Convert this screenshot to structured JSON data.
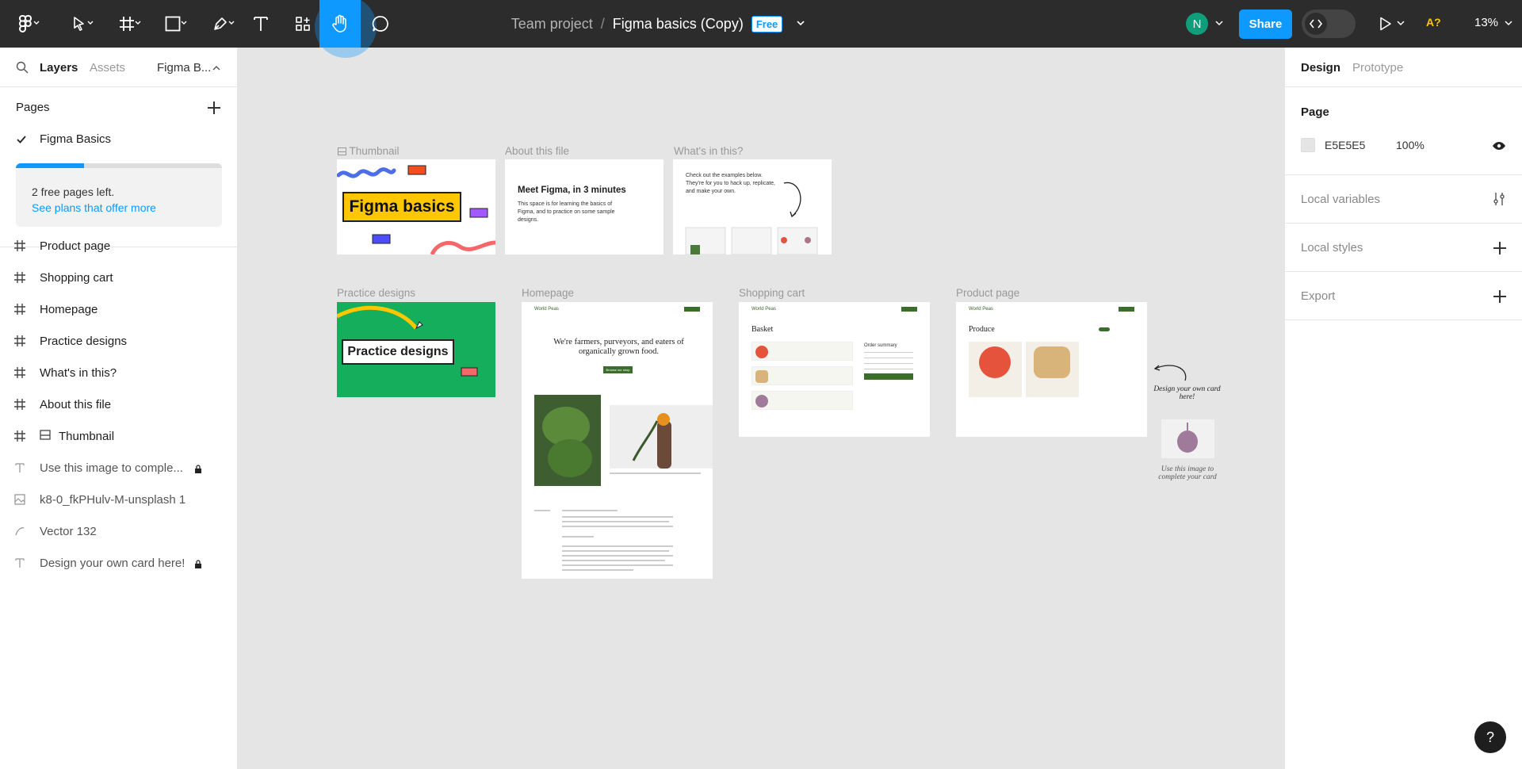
{
  "toolbar": {
    "project": "Team project",
    "separator": "/",
    "file_name": "Figma basics (Copy)",
    "plan_badge": "Free",
    "avatar_initial": "N",
    "share_label": "Share",
    "accessibility_label": "A?",
    "zoom": "13%",
    "active_tool": "hand-tool",
    "accent": "#0d99ff"
  },
  "left_panel": {
    "tabs": [
      "Layers",
      "Assets"
    ],
    "file_tab": "Figma B...",
    "pages_heading": "Pages",
    "current_page": "Figma Basics",
    "upgrade": {
      "line1": "2 free pages left.",
      "link": "See plans that offer more",
      "progress": 0.33
    },
    "layers": [
      {
        "icon": "frame-icon",
        "label": "Product page",
        "bold": true
      },
      {
        "icon": "frame-icon",
        "label": "Shopping cart",
        "bold": true
      },
      {
        "icon": "frame-icon",
        "label": "Homepage",
        "bold": true
      },
      {
        "icon": "frame-icon",
        "label": "Practice designs",
        "bold": true
      },
      {
        "icon": "frame-icon",
        "label": "What's in this?",
        "bold": true
      },
      {
        "icon": "frame-icon",
        "label": "About this file",
        "bold": true
      },
      {
        "icon": "frame-icon",
        "label": "Thumbnail",
        "bold": true
      },
      {
        "icon": "text-icon",
        "label": "Use this image to comple...",
        "locked": true
      },
      {
        "icon": "image-icon",
        "label": "k8-0_fkPHulv-M-unsplash 1"
      },
      {
        "icon": "vector-icon",
        "label": "Vector 132"
      },
      {
        "icon": "text-icon",
        "label": "Design your own card here!",
        "locked": true
      }
    ]
  },
  "right_panel": {
    "tabs": [
      "Design",
      "Prototype"
    ],
    "page_heading": "Page",
    "bg_color": "E5E5E5",
    "bg_opacity": "100%",
    "sections": [
      "Local variables",
      "Local styles",
      "Export"
    ]
  },
  "canvas": {
    "frames": {
      "thumbnail": {
        "label": "Thumbnail",
        "title": "Figma basics"
      },
      "about": {
        "label": "About this file",
        "heading": "Meet Figma, in 3 minutes",
        "body": "This space is for learning the basics of Figma, and to practice on some sample designs."
      },
      "whats_in": {
        "label": "What's in this?",
        "body": "Check out the examples below. They're for you to hack up, replicate, and make your own."
      },
      "practice": {
        "label": "Practice designs",
        "title": "Practice designs"
      },
      "homepage": {
        "label": "Homepage",
        "brand": "World Peas",
        "headline": "We're farmers, purveyors, and eaters of organically grown food.",
        "button": "Browse our shop"
      },
      "cart": {
        "label": "Shopping cart",
        "brand": "World Peas",
        "heading": "Basket",
        "summary": "Order summary"
      },
      "product": {
        "label": "Product page",
        "brand": "World Peas",
        "heading": "Produce"
      }
    },
    "note_card": "Design your own card here!",
    "note_image": "Use this image to complete your card"
  }
}
